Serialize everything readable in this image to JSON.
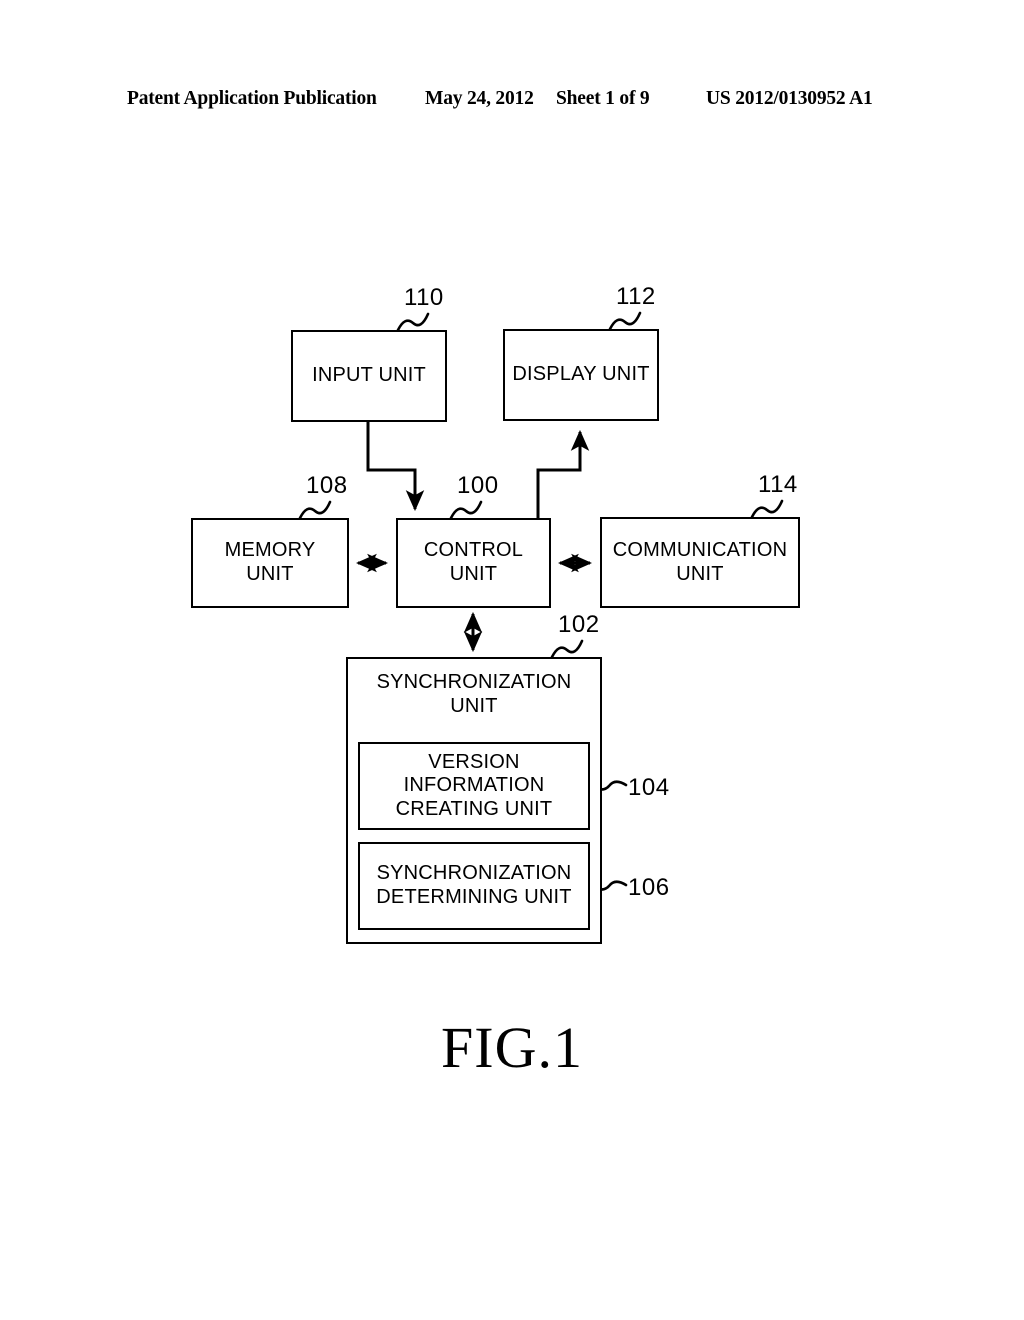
{
  "header": {
    "publication": "Patent Application Publication",
    "date": "May 24, 2012",
    "sheet": "Sheet 1 of 9",
    "patent_number": "US 2012/0130952 A1"
  },
  "figure": {
    "caption": "FIG.1",
    "boxes": [
      {
        "id": "input-unit",
        "ref": "110",
        "label": "INPUT UNIT"
      },
      {
        "id": "display-unit",
        "ref": "112",
        "label": "DISPLAY UNIT"
      },
      {
        "id": "memory-unit",
        "ref": "108",
        "label": "MEMORY\nUNIT"
      },
      {
        "id": "control-unit",
        "ref": "100",
        "label": "CONTROL\nUNIT"
      },
      {
        "id": "communication-unit",
        "ref": "114",
        "label": "COMMUNICATION\nUNIT"
      },
      {
        "id": "synchronization-unit",
        "ref": "102",
        "label": "SYNCHRONIZATION\nUNIT"
      },
      {
        "id": "version-information-creating-unit",
        "ref": "104",
        "label": "VERSION\nINFORMATION\nCREATING UNIT"
      },
      {
        "id": "synchronization-determining-unit",
        "ref": "106",
        "label": "SYNCHRONIZATION\nDETERMINING UNIT"
      }
    ],
    "connectors": [
      {
        "from": "input-unit",
        "to": "control-unit",
        "arrows": "single"
      },
      {
        "from": "control-unit",
        "to": "display-unit",
        "arrows": "single"
      },
      {
        "from": "memory-unit",
        "to": "control-unit",
        "arrows": "double"
      },
      {
        "from": "control-unit",
        "to": "communication-unit",
        "arrows": "double"
      },
      {
        "from": "control-unit",
        "to": "synchronization-unit",
        "arrows": "double"
      }
    ]
  },
  "colors": {
    "ink": "#000000",
    "paper": "#ffffff"
  }
}
